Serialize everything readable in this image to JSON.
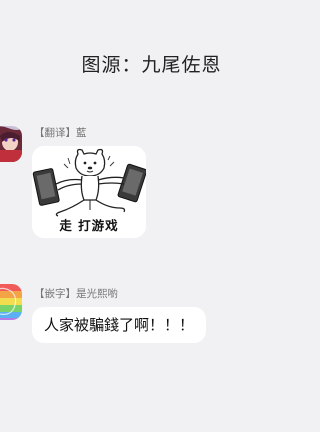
{
  "header": {
    "title": "图源：九尾佐恩"
  },
  "messages": [
    {
      "sender": "【翻译】藍",
      "avatar_icon": "anime-girl-avatar-icon",
      "sticker": {
        "icon": "cartoon-dog-playing-games-sticker",
        "caption": "走 打游戏"
      }
    },
    {
      "sender": "【嵌字】是光熙喲",
      "avatar_icon": "rainbow-avatar-icon",
      "text": "人家被騙錢了啊！！！"
    }
  ]
}
